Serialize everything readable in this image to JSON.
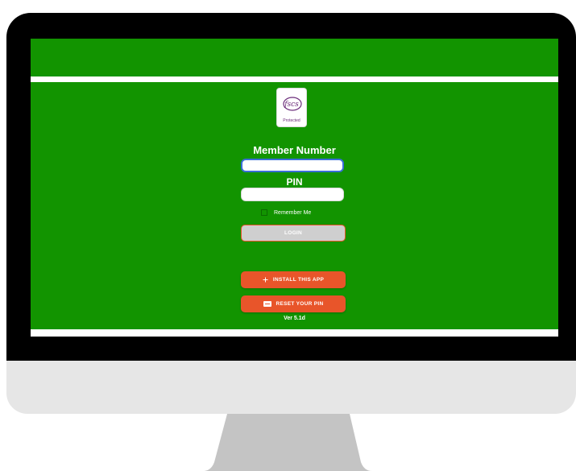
{
  "logo": {
    "text": "fscs",
    "caption": "Protected"
  },
  "form": {
    "member_label": "Member Number",
    "member_value": "",
    "pin_label": "PIN",
    "pin_value": "",
    "remember_label": "Remember Me",
    "remember_checked": false,
    "login_label": "LOGIN"
  },
  "actions": {
    "install_label": "INSTALL THIS APP",
    "install_icon": "plus-icon",
    "reset_label": "RESET YOUR PIN",
    "reset_icon": "pin-icon"
  },
  "footer": {
    "version": "Ver 5.1d"
  },
  "colors": {
    "background": "#129400",
    "accent": "#e8552a",
    "disabled": "#cfcfcf",
    "focus_border": "#3b6ed8",
    "logo_purple": "#6b2c7a"
  }
}
